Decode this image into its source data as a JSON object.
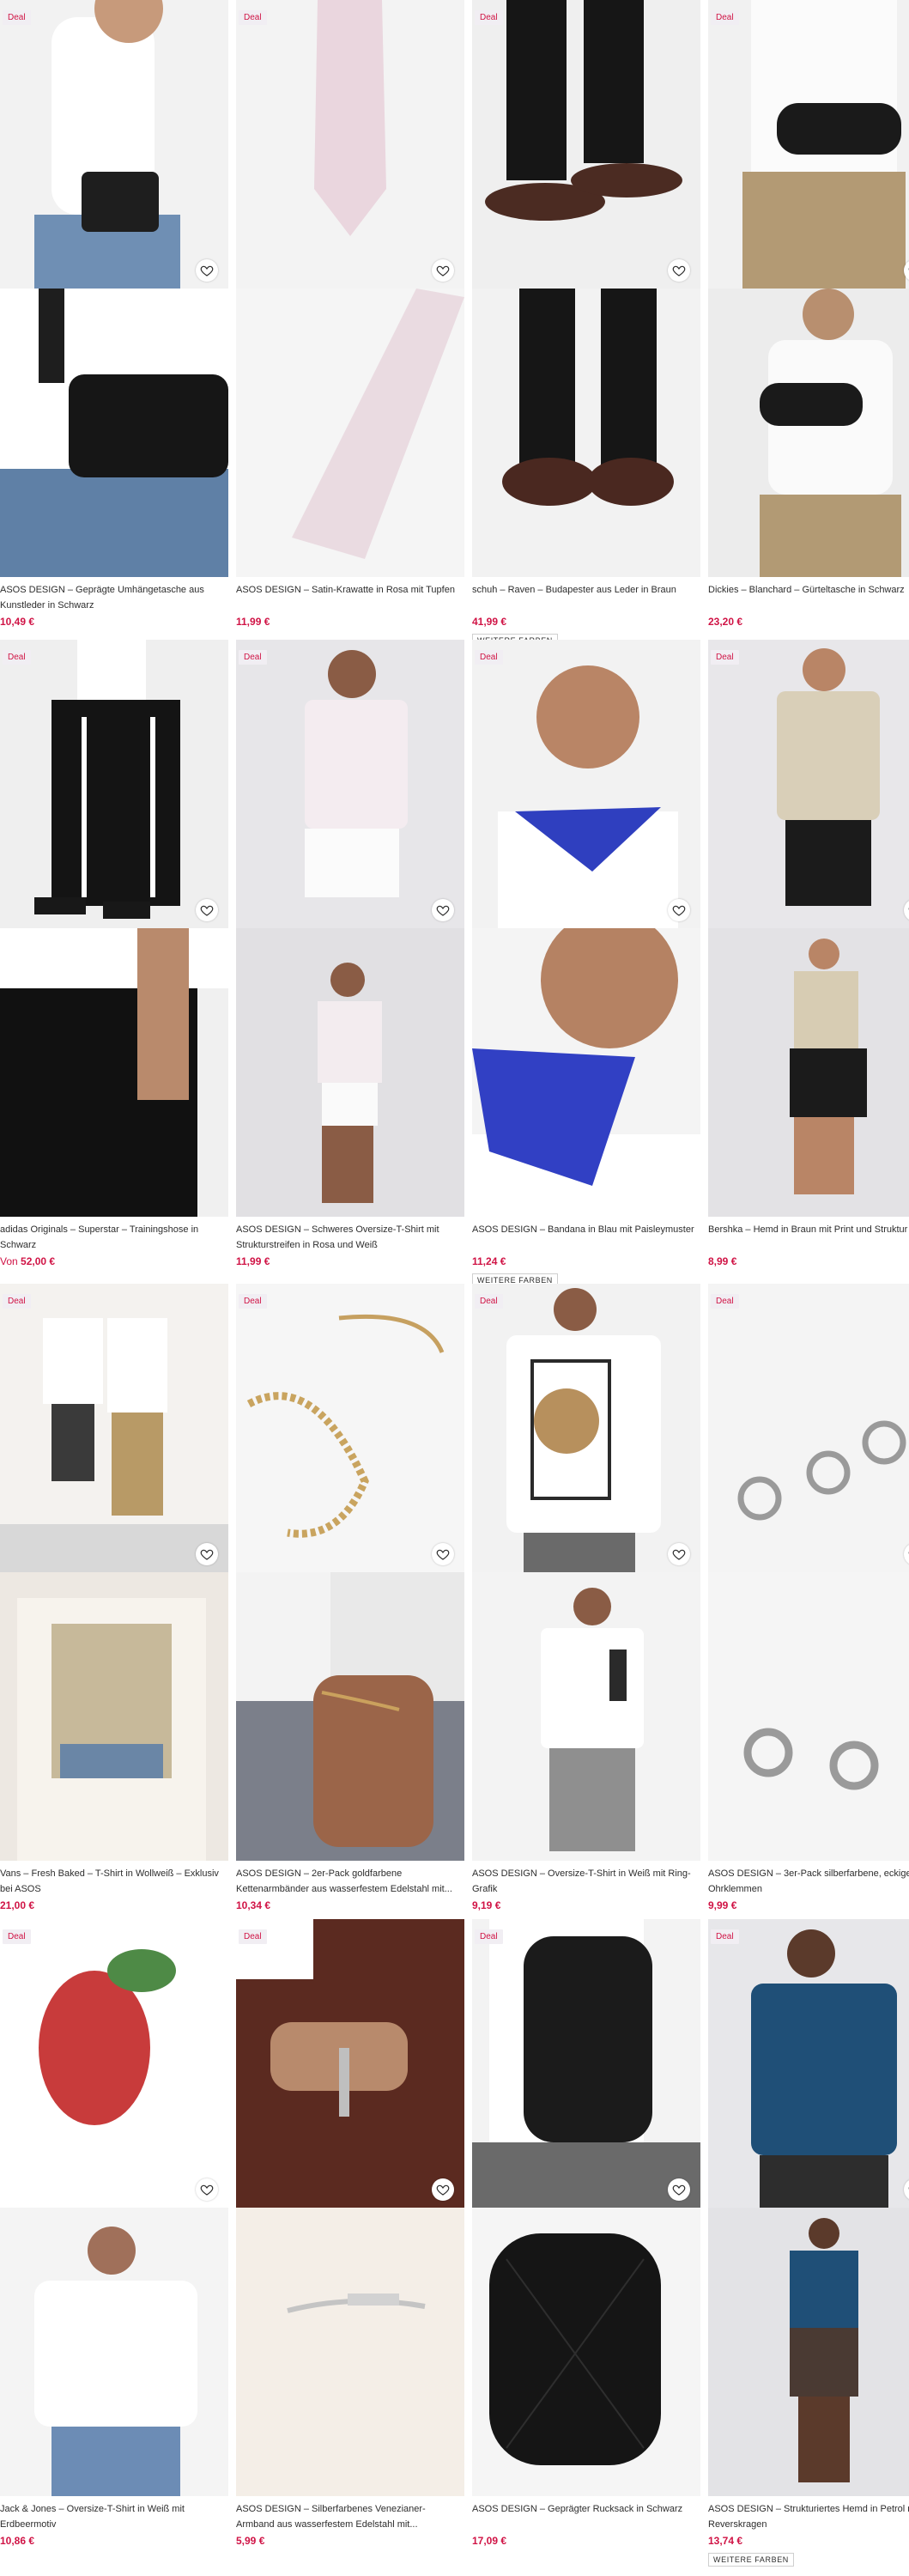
{
  "deal_label": "Deal",
  "more_colors_label": "WEITERE FARBEN",
  "colors": {
    "price": "#d01345",
    "deal_bg": "#f1eef3"
  },
  "products": [
    {
      "title": "ASOS DESIGN – Geprägte Umhängetasche aus Kunstleder in Schwarz",
      "price": "10,49 €",
      "price_prefix": "",
      "more_colors": false
    },
    {
      "title": "ASOS DESIGN – Satin-Krawatte in Rosa mit Tupfen",
      "price": "11,99 €",
      "price_prefix": "",
      "more_colors": false
    },
    {
      "title": "schuh – Raven – Budapester aus Leder in Braun",
      "price": "41,99 €",
      "price_prefix": "",
      "more_colors": true
    },
    {
      "title": "Dickies – Blanchard – Gürteltasche in Schwarz",
      "price": "23,20 €",
      "price_prefix": "",
      "more_colors": false
    },
    {
      "title": "adidas Originals – Superstar – Trainingshose in Schwarz",
      "price": "52,00 €",
      "price_prefix": "Von ",
      "more_colors": false
    },
    {
      "title": "ASOS DESIGN – Schweres Oversize-T-Shirt mit Strukturstreifen in Rosa und Weiß",
      "price": "11,99 €",
      "price_prefix": "",
      "more_colors": false
    },
    {
      "title": "ASOS DESIGN – Bandana in Blau mit Paisleymuster",
      "price": "11,24 €",
      "price_prefix": "",
      "more_colors": true
    },
    {
      "title": "Bershka – Hemd in Braun mit Print und Struktur",
      "price": "8,99 €",
      "price_prefix": "",
      "more_colors": false
    },
    {
      "title": "Vans – Fresh Baked – T-Shirt in Wollweiß – Exklusiv bei ASOS",
      "price": "21,00 €",
      "price_prefix": "",
      "more_colors": false
    },
    {
      "title": "ASOS DESIGN – 2er-Pack goldfarbene Kettenarmbänder aus wasserfestem Edelstahl mit...",
      "price": "10,34 €",
      "price_prefix": "",
      "more_colors": false
    },
    {
      "title": "ASOS DESIGN – Oversize-T-Shirt in Weiß mit Ring-Grafik",
      "price": "9,19 €",
      "price_prefix": "",
      "more_colors": false
    },
    {
      "title": "ASOS DESIGN – 3er-Pack silberfarbene, eckige Ohrklemmen",
      "price": "9,99 €",
      "price_prefix": "",
      "more_colors": false
    },
    {
      "title": "Jack & Jones – Oversize-T-Shirt in Weiß mit Erdbeermotiv",
      "price": "10,86 €",
      "price_prefix": "",
      "more_colors": false
    },
    {
      "title": "ASOS DESIGN – Silberfarbenes Venezianer-Armband aus wasserfestem Edelstahl mit...",
      "price": "5,99 €",
      "price_prefix": "",
      "more_colors": false
    },
    {
      "title": "ASOS DESIGN – Geprägter Rucksack in Schwarz",
      "price": "17,09 €",
      "price_prefix": "",
      "more_colors": false
    },
    {
      "title": "ASOS DESIGN – Strukturiertes Hemd in Petrol mit Reverskragen",
      "price": "13,74 €",
      "price_prefix": "",
      "more_colors": true
    }
  ]
}
